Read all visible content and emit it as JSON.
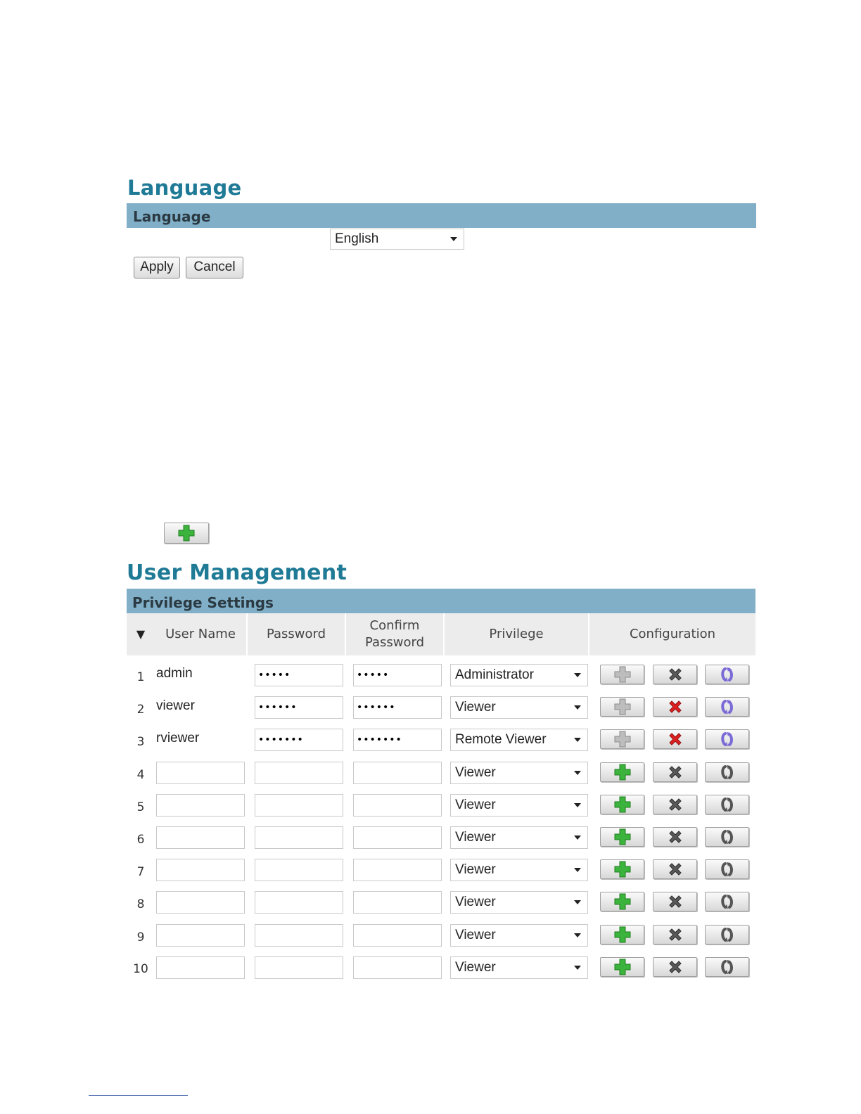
{
  "language_section": {
    "title": "Language",
    "band_label": "Language",
    "selected_language": "English",
    "apply_label": "Apply",
    "cancel_label": "Cancel"
  },
  "user_management": {
    "title": "User Management",
    "band_label": "Privilege Settings",
    "sort_indicator": "▼",
    "columns": {
      "user_name": "User Name",
      "password": "Password",
      "confirm_password_line1": "Confirm",
      "confirm_password_line2": "Password",
      "privilege": "Privilege",
      "configuration": "Configuration"
    },
    "rows": [
      {
        "num": "1",
        "user_name": "admin",
        "password": "•••••",
        "confirm_password": "•••••",
        "privilege": "Administrator"
      },
      {
        "num": "2",
        "user_name": "viewer",
        "password": "••••••",
        "confirm_password": "••••••",
        "privilege": "Viewer"
      },
      {
        "num": "3",
        "user_name": "rviewer",
        "password": "•••••••",
        "confirm_password": "•••••••",
        "privilege": "Remote Viewer"
      },
      {
        "num": "4",
        "user_name": "",
        "password": "",
        "confirm_password": "",
        "privilege": "Viewer"
      },
      {
        "num": "5",
        "user_name": "",
        "password": "",
        "confirm_password": "",
        "privilege": "Viewer"
      },
      {
        "num": "6",
        "user_name": "",
        "password": "",
        "confirm_password": "",
        "privilege": "Viewer"
      },
      {
        "num": "7",
        "user_name": "",
        "password": "",
        "confirm_password": "",
        "privilege": "Viewer"
      },
      {
        "num": "8",
        "user_name": "",
        "password": "",
        "confirm_password": "",
        "privilege": "Viewer"
      },
      {
        "num": "9",
        "user_name": "",
        "password": "",
        "confirm_password": "",
        "privilege": "Viewer"
      },
      {
        "num": "10",
        "user_name": "",
        "password": "",
        "confirm_password": "",
        "privilege": "Viewer"
      }
    ]
  },
  "icons": {
    "add_active": "plus-icon-green",
    "add_disabled": "plus-icon-gray",
    "delete_active": "x-icon-red",
    "delete_disabled": "x-icon-gray",
    "modify_active": "refresh-icon-purple",
    "modify_disabled": "refresh-icon-gray"
  },
  "colors": {
    "heading": "#1f7a96",
    "band": "#80afc7",
    "add_green": "#3cb33c",
    "delete_red": "#e02020",
    "modify_purple": "#7a6bd6"
  }
}
